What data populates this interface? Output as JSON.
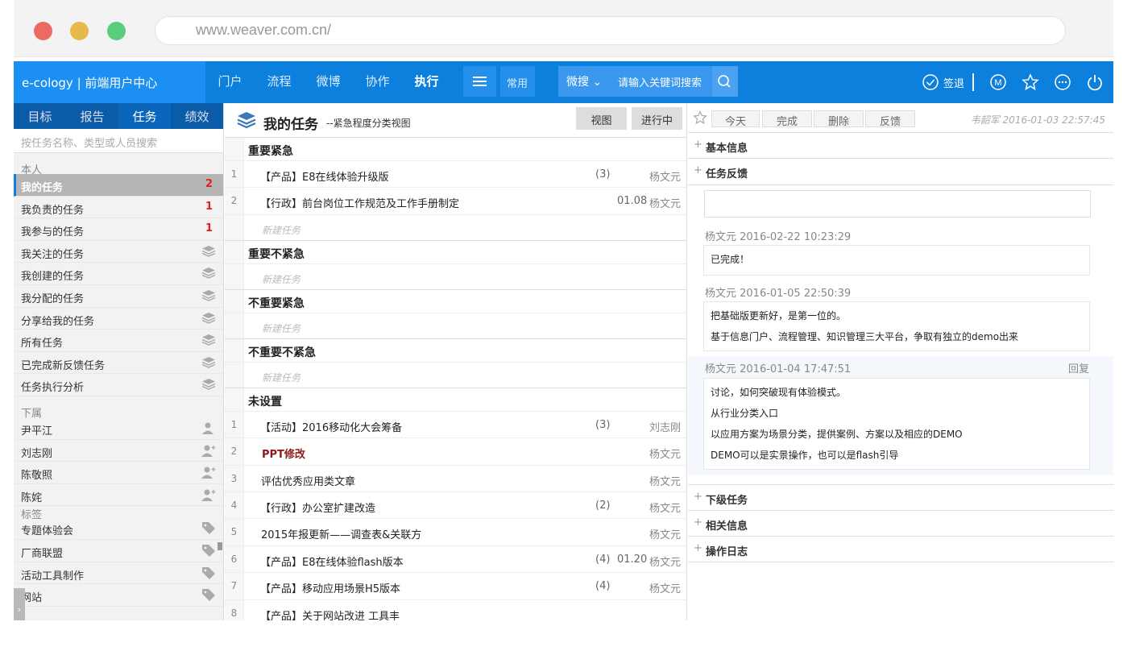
{
  "browser": {
    "url": "www.weaver.com.cn/"
  },
  "topbar": {
    "brand": "e-cology | 前端用户中心",
    "nav": [
      "门户",
      "流程",
      "微博",
      "协作",
      "执行"
    ],
    "common": "常用",
    "search_type": "微搜",
    "search_placeholder": "请输入关键词搜索",
    "sign_out": "签退"
  },
  "left": {
    "tabs": [
      "目标",
      "报告",
      "任务",
      "绩效"
    ],
    "search_placeholder": "按任务名称、类型或人员搜索",
    "sections": {
      "self": "本人",
      "subordinates": "下属",
      "tags": "标签"
    },
    "self_items": [
      {
        "label": "我的任务",
        "count": "2"
      },
      {
        "label": "我负责的任务",
        "count": "1"
      },
      {
        "label": "我参与的任务",
        "count": "1"
      },
      {
        "label": "我关注的任务"
      },
      {
        "label": "我创建的任务"
      },
      {
        "label": "我分配的任务"
      },
      {
        "label": "分享给我的任务"
      },
      {
        "label": "所有任务"
      },
      {
        "label": "已完成新反馈任务"
      },
      {
        "label": "任务执行分析"
      }
    ],
    "subordinates": [
      "尹平江",
      "刘志刚",
      "陈敬照",
      "陈姹"
    ],
    "tags": [
      "专题体验会",
      "厂商联盟",
      "活动工具制作",
      "网站"
    ]
  },
  "middle": {
    "title": "我的任务",
    "subtitle": "--紧急程度分类视图",
    "btn_view": "视图",
    "btn_progress": "进行中",
    "groups": {
      "g1": "重要紧急",
      "g2": "重要不紧急",
      "g3": "不重要紧急",
      "g4": "不重要不紧急",
      "g5": "未设置"
    },
    "new_task": "新建任务",
    "rows_g1": [
      {
        "n": "1",
        "name": "【产品】E8在线体验升级版",
        "count": "(3)",
        "date": "",
        "owner": "杨文元"
      },
      {
        "n": "2",
        "name": "【行政】前台岗位工作规范及工作手册制定",
        "count": "",
        "date": "01.08",
        "owner": "杨文元"
      }
    ],
    "rows_g5": [
      {
        "n": "1",
        "name": "【活动】2016移动化大会筹备",
        "count": "(3)",
        "date": "",
        "owner": "刘志刚"
      },
      {
        "n": "2",
        "name": "PPT修改",
        "count": "",
        "date": "",
        "owner": "杨文元"
      },
      {
        "n": "3",
        "name": "评估优秀应用类文章",
        "count": "",
        "date": "",
        "owner": "杨文元"
      },
      {
        "n": "4",
        "name": "【行政】办公室扩建改造",
        "count": "(2)",
        "date": "",
        "owner": "杨文元"
      },
      {
        "n": "5",
        "name": "2015年报更新——调查表&关联方",
        "count": "",
        "date": "",
        "owner": "杨文元"
      },
      {
        "n": "6",
        "name": "【产品】E8在线体验flash版本",
        "count": "(4)",
        "date": "01.20",
        "owner": "杨文元"
      },
      {
        "n": "7",
        "name": "【产品】移动应用场景H5版本",
        "count": "(4)",
        "date": "",
        "owner": "杨文元"
      },
      {
        "n": "8",
        "name": "【产品】关于网站改进 工具丰",
        "count": "",
        "date": "",
        "owner": ""
      }
    ]
  },
  "right": {
    "buttons": [
      "今天",
      "完成",
      "删除",
      "反馈"
    ],
    "meta": "韦韶军 2016-01-03 22:57:45",
    "sections": {
      "basic": "基本信息",
      "feedback": "任务反馈",
      "subtasks": "下级任务",
      "related": "相关信息",
      "log": "操作日志"
    },
    "reply": "回复",
    "feedbacks": [
      {
        "who": "杨文元 2016-02-22 10:23:29",
        "lines": [
          "已完成！"
        ]
      },
      {
        "who": "杨文元 2016-01-05 22:50:39",
        "lines": [
          "把基础版更新好，是第一位的。",
          "基于信息门户、流程管理、知识管理三大平台，争取有独立的demo出来"
        ]
      },
      {
        "who": "杨文元 2016-01-04 17:47:51",
        "lines": [
          "讨论，如何突破现有体验模式。",
          "从行业分类入口",
          "以应用方案为场景分类，提供案例、方案以及相应的DEMO",
          "DEMO可以是实景操作，也可以是flash引导"
        ]
      }
    ]
  }
}
